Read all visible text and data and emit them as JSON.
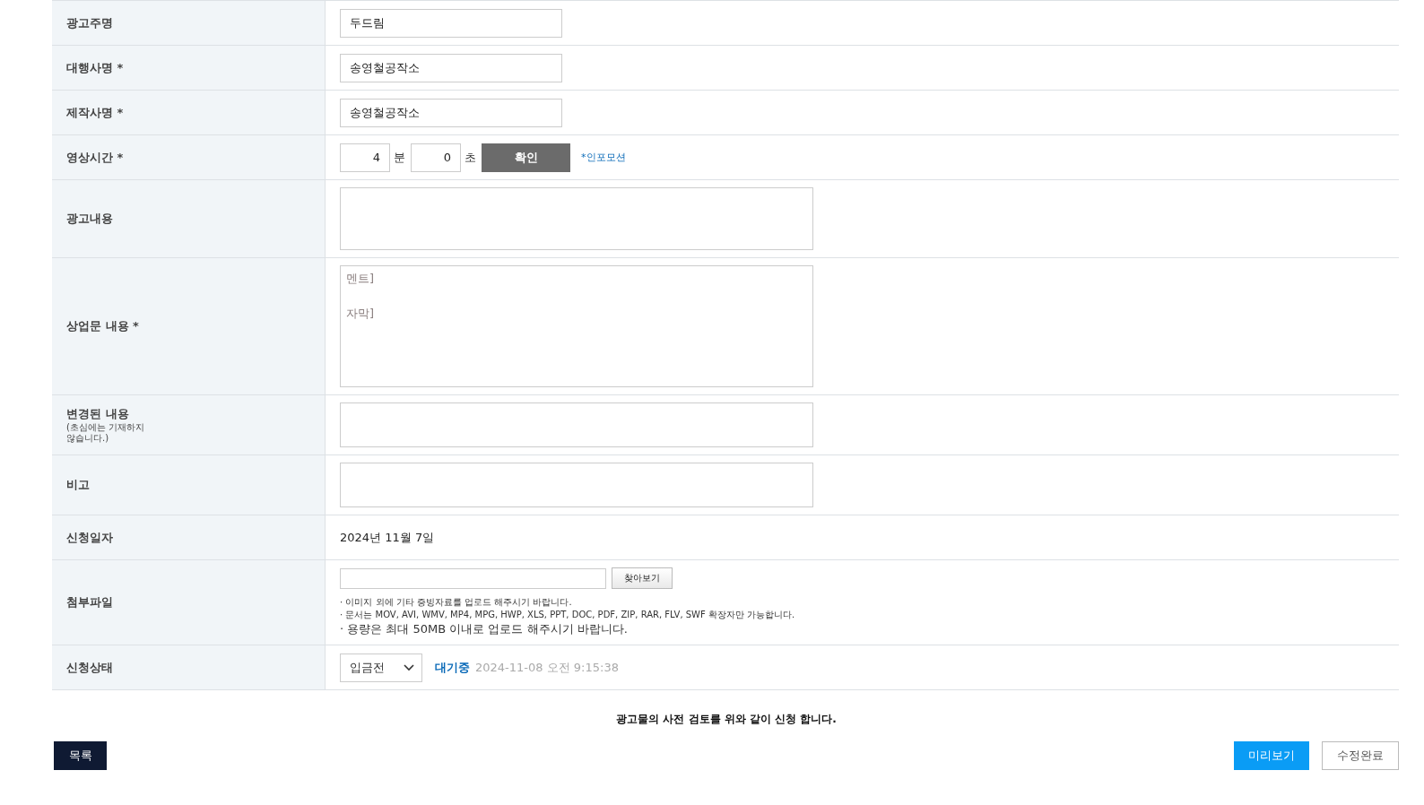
{
  "form": {
    "rows": [
      {
        "kind": "text",
        "label": "광고주명",
        "value": "두드림"
      },
      {
        "kind": "text",
        "label": "대행사명",
        "mark": "*",
        "value": "송영철공작소"
      },
      {
        "kind": "text",
        "label": "제작사명",
        "mark": "*",
        "value": "송영철공작소"
      },
      {
        "kind": "duration",
        "label": "영상시간",
        "mark": "*",
        "minutes": "4",
        "minutes_unit": "분",
        "seconds": "0",
        "seconds_unit": "초",
        "button": "확인",
        "link": "*인포모션"
      },
      {
        "kind": "textarea",
        "label": "광고내용"
      },
      {
        "kind": "tall-textarea",
        "label": "상업문 내용",
        "mark": "*",
        "placeholder": "멘트]\n\n자막]"
      },
      {
        "kind": "short-textarea",
        "label": "변경된 내용",
        "note": "(초심에는 기재하지\n않습니다.)"
      },
      {
        "kind": "short-textarea",
        "label": "비고"
      },
      {
        "kind": "date",
        "label": "신청일자",
        "value": "2024년 11월 7일"
      },
      {
        "kind": "file",
        "label": "첨부파일",
        "button": "찾아보기",
        "notes": [
          "· 이미지 외에 기타 증빙자료를 업로드 해주시기 바랍니다.",
          "· 문서는 MOV, AVI, WMV, MP4, MPG, HWP, XLS, PPT, DOC, PDF, ZIP, RAR, FLV, SWF 확장자만 가능합니다.",
          "· 용량은 최대 50MB 이내로 업로드 해주시기 바랍니다."
        ]
      },
      {
        "kind": "status",
        "label": "신청상태",
        "select": "입금전",
        "status": "대기중",
        "time": "2024-11-08 오전 9:15:38"
      }
    ]
  },
  "footer": {
    "notice": "광고물의 사전 검토를 위와 같이 신청 합니다.",
    "buttons": [
      {
        "kind": "dark",
        "label": "목록"
      },
      {
        "kind": "primary",
        "label": "미리보기"
      },
      {
        "kind": "outline",
        "label": "수정완료"
      }
    ]
  }
}
